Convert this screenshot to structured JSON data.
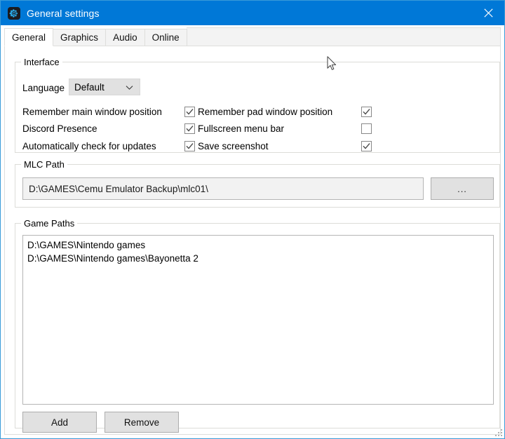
{
  "window": {
    "title": "General settings",
    "icon": "gear-icon",
    "close_label": "✕",
    "accent_color": "#0078d7",
    "frame_border_color": "#3a9bd9"
  },
  "tabs": [
    {
      "label": "General",
      "selected": true
    },
    {
      "label": "Graphics",
      "selected": false
    },
    {
      "label": "Audio",
      "selected": false
    },
    {
      "label": "Online",
      "selected": false
    }
  ],
  "interface": {
    "group_title": "Interface",
    "language_label": "Language",
    "language_value": "Default",
    "language_chevron": "chevron-down-icon",
    "options_left": [
      {
        "label": "Remember main window position",
        "checked": true
      },
      {
        "label": "Discord Presence",
        "checked": true
      },
      {
        "label": "Automatically check for updates",
        "checked": true
      }
    ],
    "options_right": [
      {
        "label": "Remember pad window position",
        "checked": true
      },
      {
        "label": "Fullscreen menu bar",
        "checked": false
      },
      {
        "label": "Save screenshot",
        "checked": true
      }
    ]
  },
  "mlc": {
    "group_title": "MLC Path",
    "path_value": "D:\\GAMES\\Cemu Emulator Backup\\mlc01\\",
    "browse_label": "..."
  },
  "game_paths": {
    "group_title": "Game Paths",
    "items": [
      "D:\\GAMES\\Nintendo games",
      "D:\\GAMES\\Nintendo games\\Bayonetta 2"
    ],
    "add_label": "Add",
    "remove_label": "Remove"
  }
}
